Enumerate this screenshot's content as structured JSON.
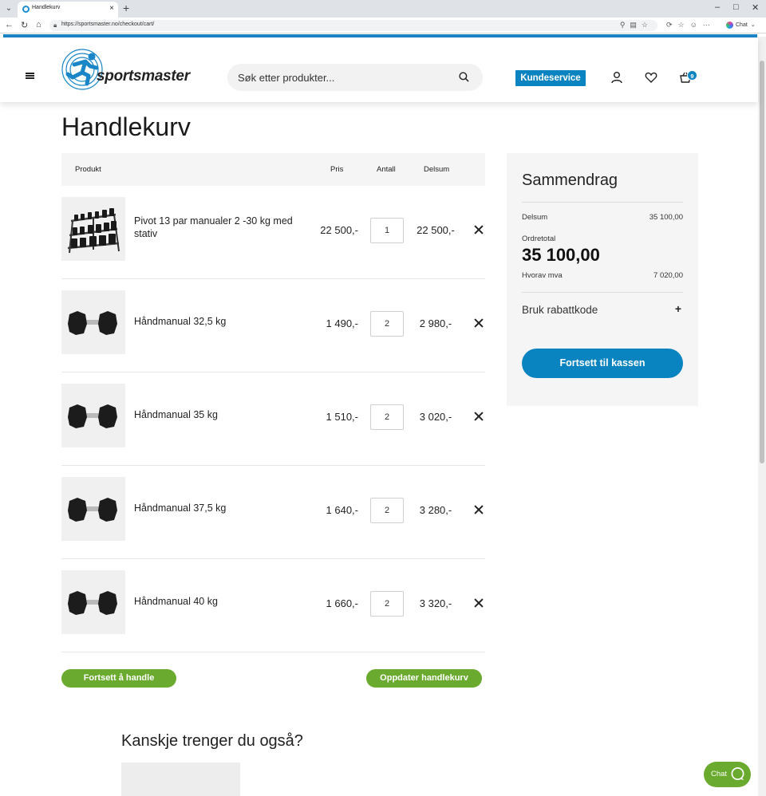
{
  "browser": {
    "tab_title": "Handlekurv",
    "url": "https://sportsmaster.no/checkout/cart/",
    "chat_label": "Chat"
  },
  "header": {
    "logo_text": "sportsmaster",
    "search_placeholder": "Søk etter produkter...",
    "kundeservice": "Kundeservice",
    "cart_count": "9"
  },
  "cart": {
    "title": "Handlekurv",
    "columns": {
      "product": "Produkt",
      "price": "Pris",
      "qty": "Antall",
      "subtotal": "Delsum"
    },
    "items": [
      {
        "name": "Pivot 13 par manualer 2 -30 kg med stativ",
        "price": "22 500,-",
        "qty": "1",
        "subtotal": "22 500,-"
      },
      {
        "name": "Håndmanual 32,5 kg",
        "price": "1 490,-",
        "qty": "2",
        "subtotal": "2 980,-"
      },
      {
        "name": "Håndmanual 35 kg",
        "price": "1 510,-",
        "qty": "2",
        "subtotal": "3 020,-"
      },
      {
        "name": "Håndmanual 37,5 kg",
        "price": "1 640,-",
        "qty": "2",
        "subtotal": "3 280,-"
      },
      {
        "name": "Håndmanual 40 kg",
        "price": "1 660,-",
        "qty": "2",
        "subtotal": "3 320,-"
      }
    ],
    "continue_shopping": "Fortsett å handle",
    "update_cart": "Oppdater handlekurv"
  },
  "summary": {
    "title": "Sammendrag",
    "subtotal_label": "Delsum",
    "subtotal_value": "35 100,00",
    "order_total_label": "Ordretotal",
    "order_total_value": "35 100,00",
    "vat_label": "Hvorav mva",
    "vat_value": "7 020,00",
    "discount_label": "Bruk rabattkode",
    "discount_toggle": "+",
    "checkout_button": "Fortsett til kassen"
  },
  "upsell": {
    "title": "Kanskje trenger du også?"
  },
  "chat_widget": {
    "label": "Chat"
  }
}
